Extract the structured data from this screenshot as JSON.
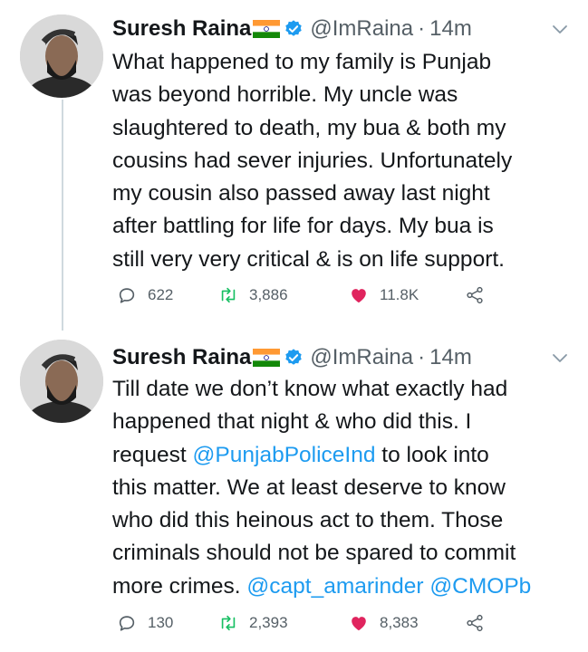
{
  "tweets": [
    {
      "name": "Suresh Raina",
      "handle": "@ImRaina",
      "separator": "·",
      "time": "14m",
      "lines": [
        [
          {
            "text": "What happened to my family is Punjab"
          }
        ],
        [
          {
            "text": "was beyond horrible. My uncle was"
          }
        ],
        [
          {
            "text": "slaughtered to death, my bua & both my"
          }
        ],
        [
          {
            "text": "cousins had sever injuries. Unfortunately"
          }
        ],
        [
          {
            "text": "my cousin also passed away last night"
          }
        ],
        [
          {
            "text": "after battling for life for days. My bua is"
          }
        ],
        [
          {
            "text": "still very very critical & is on life support."
          }
        ]
      ],
      "replies": "622",
      "retweets": "3,886",
      "likes": "11.8K"
    },
    {
      "name": "Suresh Raina",
      "handle": "@ImRaina",
      "separator": "·",
      "time": "14m",
      "lines": [
        [
          {
            "text": "Till date we don’t know what exactly had"
          }
        ],
        [
          {
            "text": "happened that night & who did this. I"
          }
        ],
        [
          {
            "text": "request "
          },
          {
            "text": "@PunjabPoliceInd",
            "mention": true
          },
          {
            "text": " to look into"
          }
        ],
        [
          {
            "text": "this matter. We at least deserve to know"
          }
        ],
        [
          {
            "text": "who did this heinous act to them. Those"
          }
        ],
        [
          {
            "text": "criminals should not be spared to commit"
          }
        ],
        [
          {
            "text": "more crimes. "
          },
          {
            "text": "@capt_amarinder",
            "mention": true
          },
          {
            "text": " "
          },
          {
            "text": "@CMOPb",
            "mention": true
          }
        ]
      ],
      "replies": "130",
      "retweets": "2,393",
      "likes": "8,383"
    }
  ],
  "icons": {
    "reply": "reply-icon",
    "retweet": "retweet-icon",
    "like": "heart-icon",
    "share": "share-icon",
    "verified": "verified-badge-icon",
    "flag": "india-flag-icon",
    "more": "chevron-down-icon"
  },
  "colors": {
    "text": "#14171a",
    "secondary": "#555f66",
    "link": "#1d9bf0",
    "verified": "#1d9bf0",
    "like": "#e0245e",
    "retweet": "#17bf63"
  }
}
